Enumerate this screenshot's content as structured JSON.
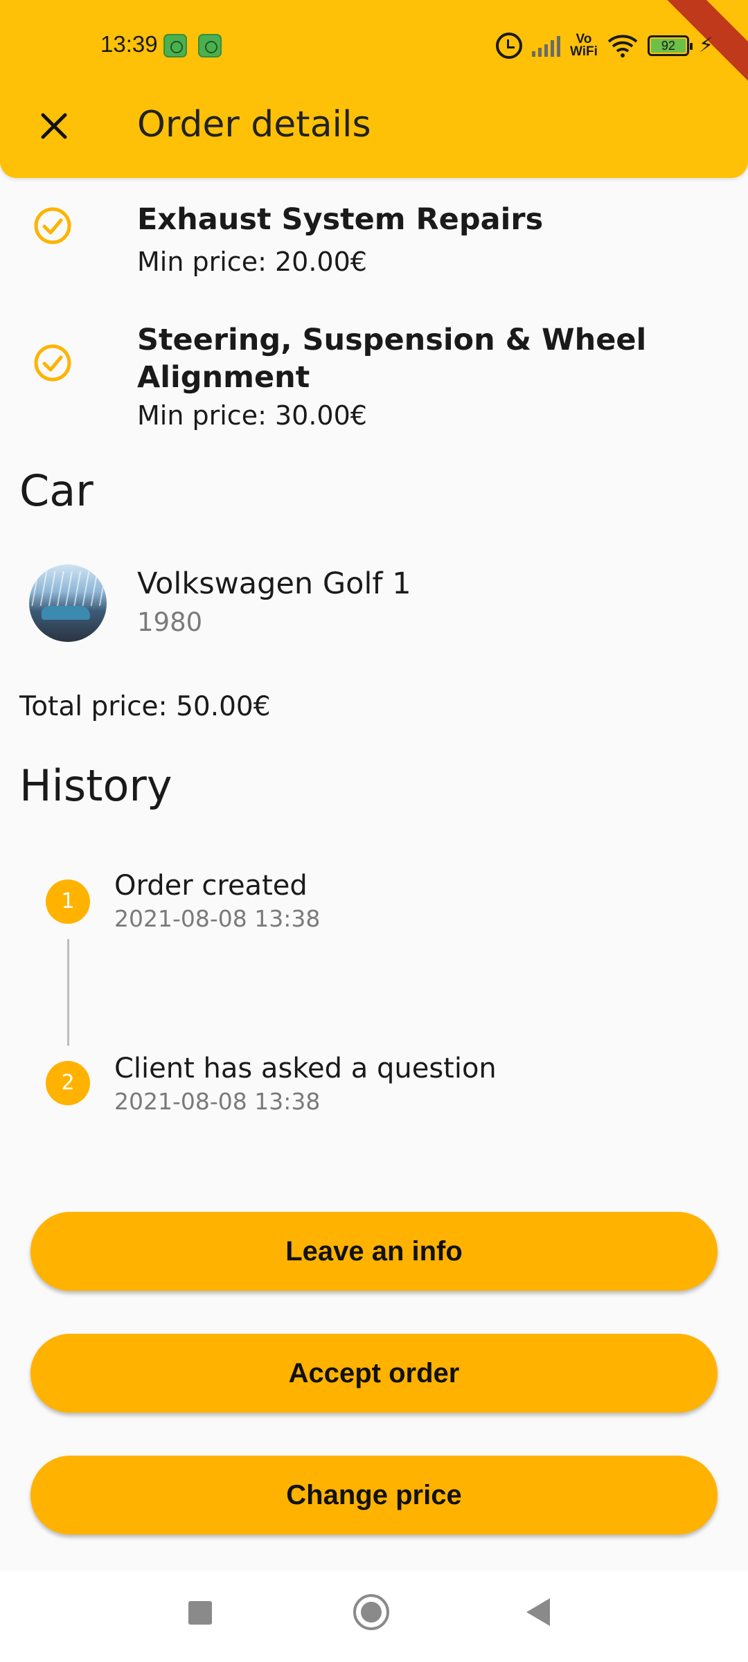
{
  "status_bar": {
    "time": "13:39",
    "battery": "92",
    "vowifi_top": "Vo",
    "vowifi_bottom": "WiFi"
  },
  "header": {
    "title": "Order details",
    "close_icon": "close-icon"
  },
  "services": [
    {
      "name": "Exhaust System Repairs",
      "price": "Min price: 20.00€",
      "icon": "check-circle-icon"
    },
    {
      "name": "Steering, Suspension & Wheel Alignment",
      "price": "Min price: 30.00€",
      "icon": "check-circle-icon"
    }
  ],
  "car": {
    "section_title": "Car",
    "name": "Volkswagen  Golf 1",
    "year": "1980"
  },
  "total_price": "Total price: 50.00€",
  "history": {
    "section_title": "History",
    "steps": [
      {
        "number": "1",
        "title": "Order created",
        "date": "2021-08-08 13:38"
      },
      {
        "number": "2",
        "title": "Client has asked a question",
        "date": "2021-08-08 13:38"
      }
    ]
  },
  "actions": {
    "leave_info": "Leave an info",
    "accept_order": "Accept order",
    "change_price": "Change price"
  },
  "colors": {
    "header": "#FFC107",
    "accent": "#FFB300",
    "background": "#FAFAFA"
  },
  "nav_bar": {
    "recents_icon": "recents-square-icon",
    "home_icon": "home-circle-icon",
    "back_icon": "back-triangle-icon"
  }
}
